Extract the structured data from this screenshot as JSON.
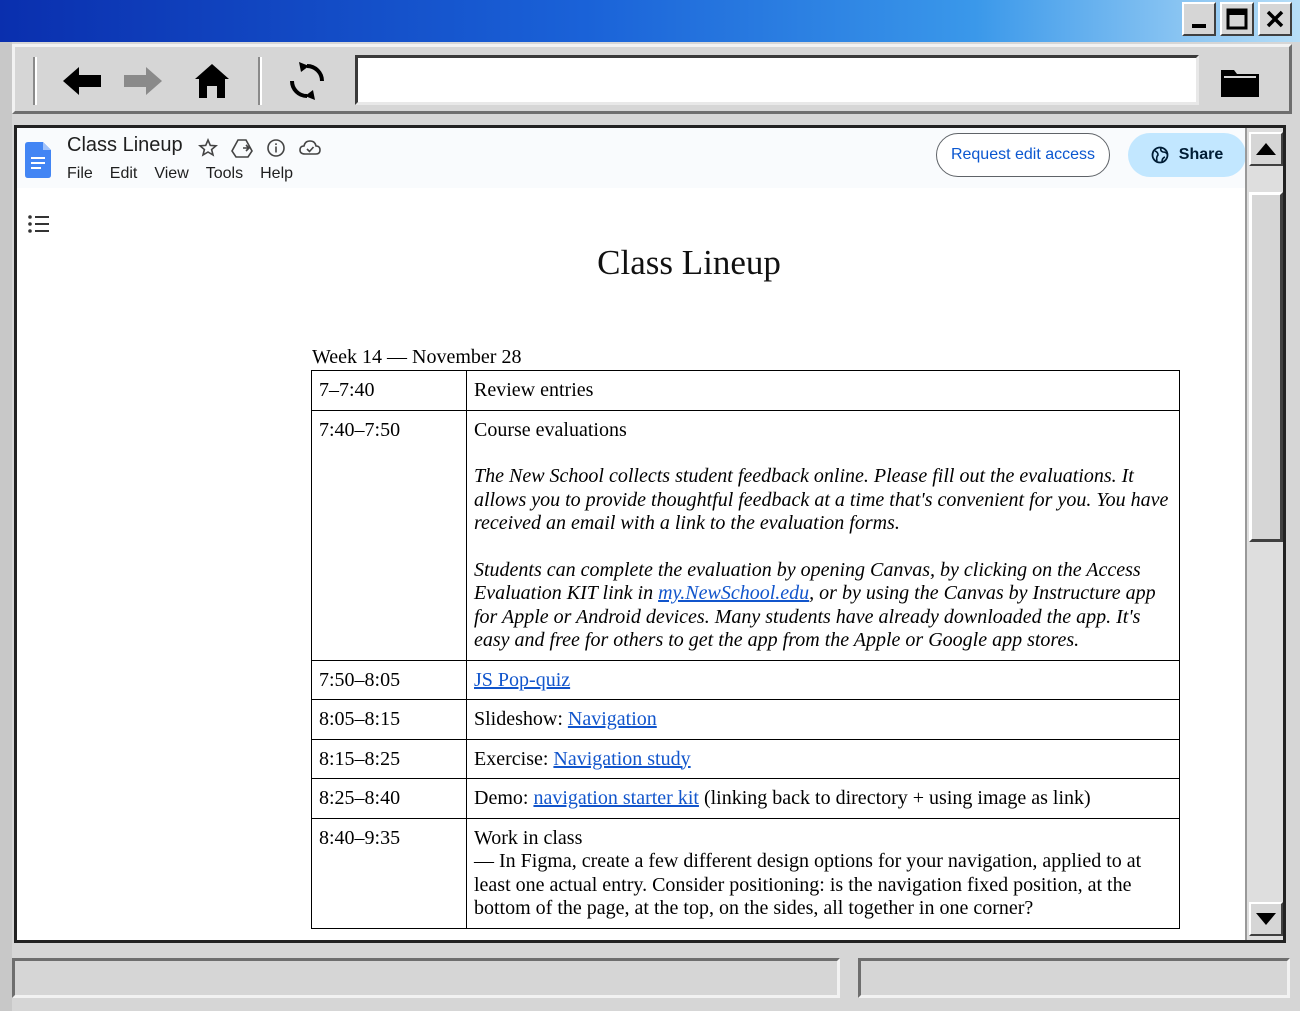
{
  "window": {
    "minimize_icon": "minimize-icon",
    "maximize_icon": "maximize-icon",
    "close_icon": "close-icon"
  },
  "toolbar": {
    "back_icon": "back-arrow-icon",
    "forward_icon": "forward-arrow-icon",
    "home_icon": "home-icon",
    "reload_icon": "reload-icon",
    "address_value": "",
    "folder_icon": "folder-icon"
  },
  "docs": {
    "title": "Class Lineup",
    "menu": [
      "File",
      "Edit",
      "View",
      "Tools",
      "Help"
    ],
    "request_edit_label": "Request edit access",
    "share_label": "Share"
  },
  "document": {
    "heading": "Class Lineup",
    "week_label": "Week 14 — November 28",
    "rows": [
      {
        "time": "7–7:40",
        "text": "Review entries"
      },
      {
        "time": "7:40–7:50",
        "text": "Course evaluations",
        "para1": "The New School collects student feedback online. Please fill out the evaluations. It allows you to provide thoughtful feedback at a time that's convenient for you. You have received an email with a link to the evaluation forms.",
        "para2_before": "Students can complete the evaluation by opening Canvas, by clicking on the Access Evaluation KIT link in ",
        "para2_link": "my.NewSchool.edu",
        "para2_after": ", or by using the Canvas by Instructure app for Apple or Android devices. Many students have already downloaded the app. It's easy and free for others to get the app from the Apple or Google app stores."
      },
      {
        "time": "7:50–8:05",
        "link": "JS Pop-quiz"
      },
      {
        "time": "8:05–8:15",
        "prefix": "Slideshow: ",
        "link": "Navigation"
      },
      {
        "time": "8:15–8:25",
        "prefix": "Exercise: ",
        "link": "Navigation study"
      },
      {
        "time": "8:25–8:40",
        "prefix": "Demo: ",
        "link": "navigation starter kit",
        "suffix": " (linking back to directory + using image as link)"
      },
      {
        "time": "8:40–9:35",
        "text": "Work in class",
        "detail": "— In Figma, create a few different design options for your navigation, applied to at least one actual entry. Consider positioning: is the navigation fixed position, at the bottom of the page, at the top, on the sides, all together in one corner?"
      }
    ]
  },
  "colors": {
    "link": "#1155cc",
    "share_bg": "#c2e7ff",
    "request_text": "#0b57d0"
  }
}
